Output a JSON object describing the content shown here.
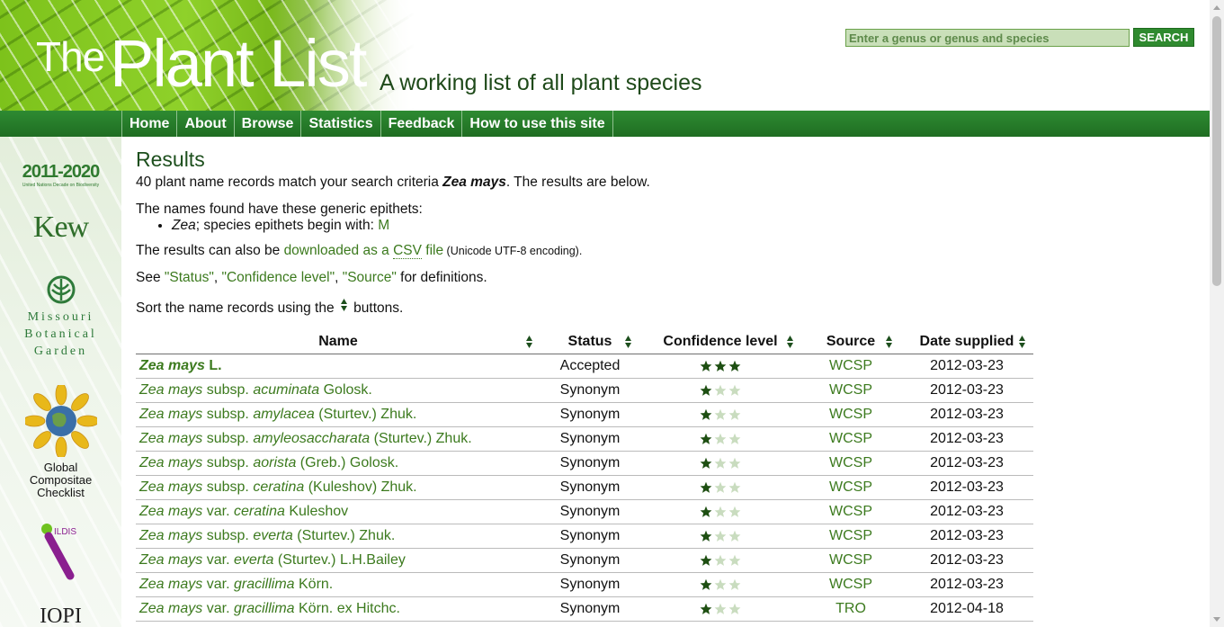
{
  "header": {
    "logo_the": "The",
    "logo_plantlist": "Plant List",
    "tagline": "A working list of all plant species",
    "search_placeholder": "Enter a genus or genus and species",
    "search_button": "SEARCH"
  },
  "nav": {
    "items": [
      "Home",
      "About",
      "Browse",
      "Statistics",
      "Feedback",
      "How to use this site"
    ]
  },
  "sidebar": {
    "undb_big": "2011-2020",
    "undb_small": "United Nations Decade on Biodiversity",
    "kew": "Kew",
    "mbg_lines": [
      "Missouri",
      "Botanical",
      "Garden"
    ],
    "gcc_lines": [
      "Global",
      "Compositae",
      "Checklist"
    ],
    "ildis": "ILDIS",
    "ipni": "IOPI"
  },
  "main": {
    "title": "Results",
    "count_prefix": "40 plant name records match your search criteria ",
    "query": "Zea mays",
    "count_suffix": ". The results are below.",
    "generic_intro": "The names found have these generic epithets:",
    "genus": "Zea",
    "species_text": "; species epithets begin with: ",
    "species_letter": "M",
    "download_prefix": "The results can also be ",
    "download_link_a": "downloaded as a ",
    "download_link_abbr": "CSV",
    "download_link_b": " file",
    "download_note": " (Unicode UTF-8 encoding).",
    "see_prefix": "See ",
    "def_status": "\"Status\"",
    "def_conf": "\"Confidence level\"",
    "def_source": "\"Source\"",
    "see_suffix": " for definitions.",
    "sep1": ", ",
    "sep2": ", ",
    "sort_prefix": "Sort the name records using the ",
    "sort_suffix": " buttons."
  },
  "table": {
    "headers": [
      "Name",
      "Status",
      "Confidence level",
      "Source",
      "Date supplied"
    ],
    "rows": [
      {
        "genus": "Zea",
        "species": "mays",
        "rank": "",
        "infra": "",
        "author": "L.",
        "status": "Accepted",
        "confidence": 3,
        "source": "WCSP",
        "date": "2012-03-23"
      },
      {
        "genus": "Zea",
        "species": "mays",
        "rank": "subsp.",
        "infra": "acuminata",
        "author": "Golosk.",
        "status": "Synonym",
        "confidence": 1,
        "source": "WCSP",
        "date": "2012-03-23"
      },
      {
        "genus": "Zea",
        "species": "mays",
        "rank": "subsp.",
        "infra": "amylacea",
        "author": "(Sturtev.) Zhuk.",
        "status": "Synonym",
        "confidence": 1,
        "source": "WCSP",
        "date": "2012-03-23"
      },
      {
        "genus": "Zea",
        "species": "mays",
        "rank": "subsp.",
        "infra": "amyleosaccharata",
        "author": "(Sturtev.) Zhuk.",
        "status": "Synonym",
        "confidence": 1,
        "source": "WCSP",
        "date": "2012-03-23"
      },
      {
        "genus": "Zea",
        "species": "mays",
        "rank": "subsp.",
        "infra": "aorista",
        "author": "(Greb.) Golosk.",
        "status": "Synonym",
        "confidence": 1,
        "source": "WCSP",
        "date": "2012-03-23"
      },
      {
        "genus": "Zea",
        "species": "mays",
        "rank": "subsp.",
        "infra": "ceratina",
        "author": "(Kuleshov) Zhuk.",
        "status": "Synonym",
        "confidence": 1,
        "source": "WCSP",
        "date": "2012-03-23"
      },
      {
        "genus": "Zea",
        "species": "mays",
        "rank": "var.",
        "infra": "ceratina",
        "author": "Kuleshov",
        "status": "Synonym",
        "confidence": 1,
        "source": "WCSP",
        "date": "2012-03-23"
      },
      {
        "genus": "Zea",
        "species": "mays",
        "rank": "subsp.",
        "infra": "everta",
        "author": "(Sturtev.) Zhuk.",
        "status": "Synonym",
        "confidence": 1,
        "source": "WCSP",
        "date": "2012-03-23"
      },
      {
        "genus": "Zea",
        "species": "mays",
        "rank": "var.",
        "infra": "everta",
        "author": "(Sturtev.) L.H.Bailey",
        "status": "Synonym",
        "confidence": 1,
        "source": "WCSP",
        "date": "2012-03-23"
      },
      {
        "genus": "Zea",
        "species": "mays",
        "rank": "var.",
        "infra": "gracillima",
        "author": "Körn.",
        "status": "Synonym",
        "confidence": 1,
        "source": "WCSP",
        "date": "2012-03-23"
      },
      {
        "genus": "Zea",
        "species": "mays",
        "rank": "var.",
        "infra": "gracillima",
        "author": "Körn. ex Hitchc.",
        "status": "Synonym",
        "confidence": 1,
        "source": "TRO",
        "date": "2012-04-18"
      }
    ]
  },
  "colors": {
    "accent": "#2f8a2f",
    "link": "#3c7a1e",
    "star_on": "#1e4f12",
    "star_off": "#c9dcbf"
  }
}
